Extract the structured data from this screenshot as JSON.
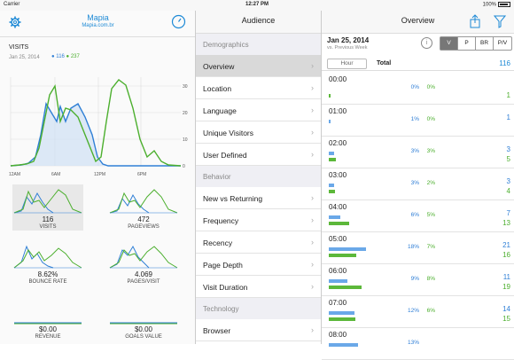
{
  "status": {
    "carrier": "Carrier",
    "time": "12:27 PM",
    "battery": "100%"
  },
  "left": {
    "app_title": "Mapia",
    "site": "Mapia.com.br",
    "metric": "VISITS",
    "date": "Jan 25, 2014",
    "legend_a": "116",
    "legend_b": "237",
    "x_ticks": [
      "12AM",
      "6AM",
      "12PM",
      "6PM"
    ],
    "y_ticks": [
      "30",
      "20",
      "10",
      "0"
    ],
    "tiles": [
      {
        "value": "116",
        "name": "VISITS",
        "selected": true
      },
      {
        "value": "472",
        "name": "PAGEVIEWS"
      },
      {
        "value": "8.62%",
        "name": "BOUNCE RATE"
      },
      {
        "value": "4.069",
        "name": "PAGES/VISIT"
      },
      {
        "value": "$0.00",
        "name": "REVENUE"
      },
      {
        "value": "$0.00",
        "name": "GOALS VALUE"
      }
    ]
  },
  "middle": {
    "title": "Audience",
    "sections": [
      {
        "header": "Demographics",
        "items": [
          "Overview",
          "Location",
          "Language",
          "Unique Visitors",
          "User Defined"
        ]
      },
      {
        "header": "Behavior",
        "items": [
          "New vs Returning",
          "Frequency",
          "Recency",
          "Page Depth",
          "Visit Duration"
        ]
      },
      {
        "header": "Technology",
        "items": [
          "Browser"
        ]
      }
    ],
    "selected": "Overview"
  },
  "right": {
    "title": "Overview",
    "date": "Jan 25, 2014",
    "compare": "vs. Previous Week",
    "segments": [
      "V",
      "P",
      "BR",
      "P/V"
    ],
    "active_segment": "V",
    "hour_btn": "Hour",
    "total_label": "Total",
    "total_value": "116",
    "rows": [
      {
        "hour": "00:00",
        "pa": "0%",
        "pb": "0%",
        "a": "",
        "b": "1",
        "fa": 0,
        "fb": 0.02
      },
      {
        "hour": "01:00",
        "pa": "1%",
        "pb": "0%",
        "a": "1",
        "b": "",
        "fa": 0.02,
        "fb": 0
      },
      {
        "hour": "02:00",
        "pa": "3%",
        "pb": "3%",
        "a": "3",
        "b": "5",
        "fa": 0.05,
        "fb": 0.07
      },
      {
        "hour": "03:00",
        "pa": "3%",
        "pb": "2%",
        "a": "3",
        "b": "4",
        "fa": 0.05,
        "fb": 0.06
      },
      {
        "hour": "04:00",
        "pa": "6%",
        "pb": "5%",
        "a": "7",
        "b": "13",
        "fa": 0.12,
        "fb": 0.21
      },
      {
        "hour": "05:00",
        "pa": "18%",
        "pb": "7%",
        "a": "21",
        "b": "16",
        "fa": 0.38,
        "fb": 0.28
      },
      {
        "hour": "06:00",
        "pa": "9%",
        "pb": "8%",
        "a": "11",
        "b": "19",
        "fa": 0.19,
        "fb": 0.34
      },
      {
        "hour": "07:00",
        "pa": "12%",
        "pb": "6%",
        "a": "14",
        "b": "15",
        "fa": 0.26,
        "fb": 0.27
      },
      {
        "hour": "08:00",
        "pa": "13%",
        "pb": "",
        "a": "",
        "b": "",
        "fa": 0.3,
        "fb": 0
      }
    ]
  },
  "colors": {
    "blue": "#2f7fd6",
    "green": "#4caf2e",
    "accent": "#1e8ad6"
  }
}
